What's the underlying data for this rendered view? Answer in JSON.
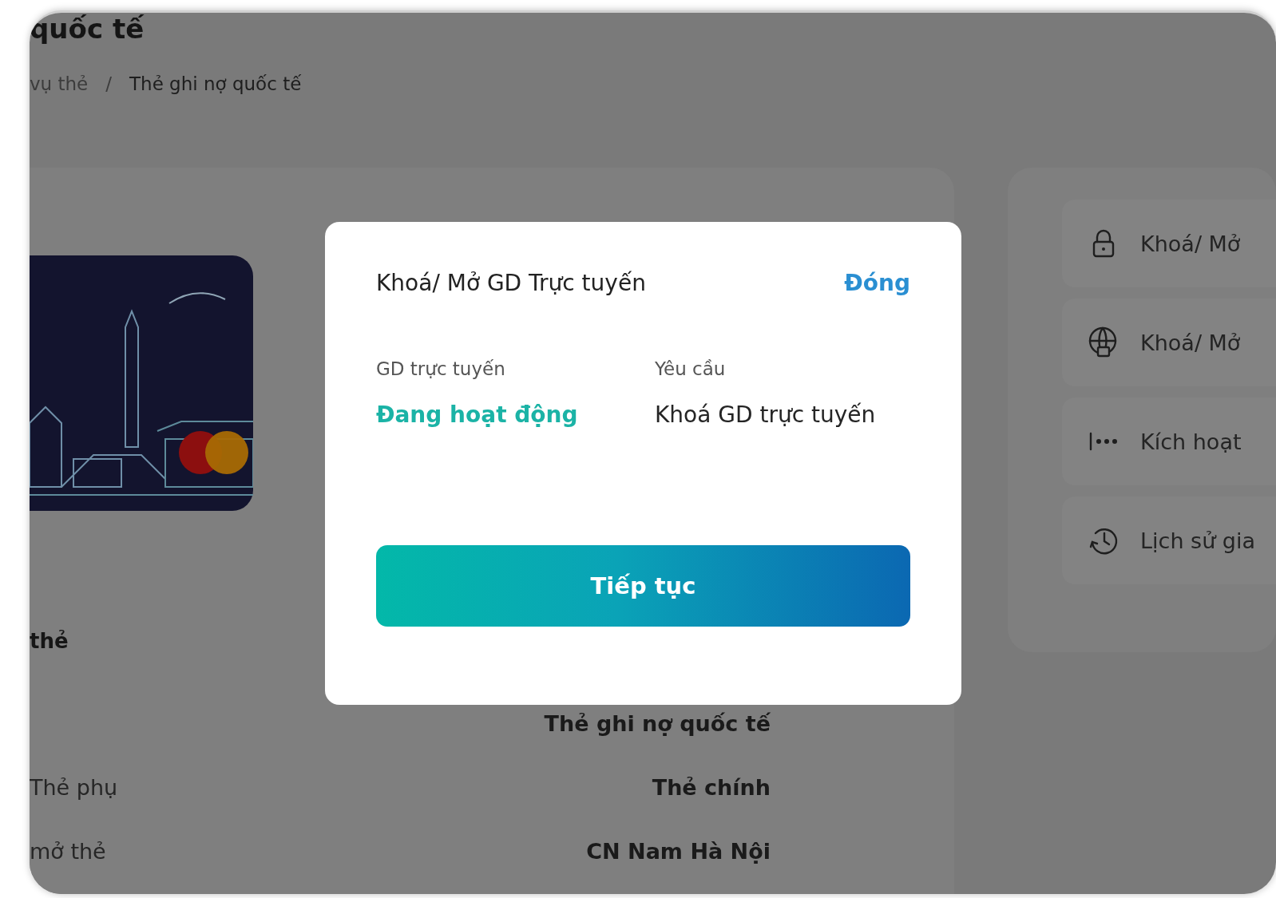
{
  "page": {
    "title": "quốc tế",
    "breadcrumb_separator": "/",
    "breadcrumb": [
      {
        "label": "vụ thẻ",
        "current": false
      },
      {
        "label": "Thẻ ghi nợ quốc tế",
        "current": true
      }
    ]
  },
  "card_panel": {
    "section_title": "thẻ",
    "rows": [
      {
        "value": "Thẻ ghi nợ quốc tế"
      },
      {
        "label": "Thẻ phụ",
        "value": "Thẻ chính"
      },
      {
        "label": "mở thẻ",
        "value": "CN Nam Hà Nội"
      }
    ]
  },
  "actions": [
    {
      "kind": "lock",
      "label": "Khoá/ Mở"
    },
    {
      "kind": "globe-lock",
      "label": "Khoá/ Mở"
    },
    {
      "kind": "dots",
      "label": "Kích hoạt"
    },
    {
      "kind": "history",
      "label": "Lịch sử gia"
    }
  ],
  "dialog": {
    "title": "Khoá/ Mở GD Trực tuyến",
    "close": "Đóng",
    "fields": [
      {
        "kind": "status",
        "label": "GD trực tuyến",
        "value": "Đang hoạt động"
      },
      {
        "kind": "plain",
        "label": "Yêu cầu",
        "value": "Khoá GD trực tuyến"
      }
    ],
    "button": "Tiếp tục"
  }
}
